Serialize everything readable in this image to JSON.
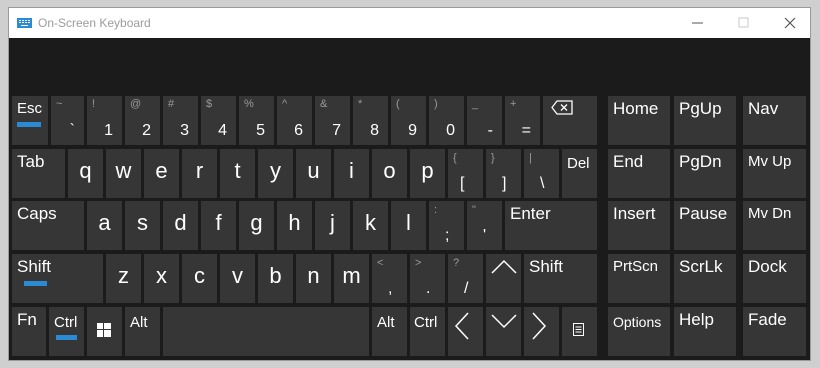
{
  "window": {
    "title": "On-Screen Keyboard",
    "accent_color": "#2a8ad3",
    "controls": [
      "minimize-icon",
      "maximize-icon",
      "close-icon"
    ]
  },
  "keys": {
    "esc": "Esc",
    "row1": [
      {
        "top": "~",
        "main": "`"
      },
      {
        "top": "!",
        "main": "1"
      },
      {
        "top": "@",
        "main": "2"
      },
      {
        "top": "#",
        "main": "3"
      },
      {
        "top": "$",
        "main": "4"
      },
      {
        "top": "%",
        "main": "5"
      },
      {
        "top": "^",
        "main": "6"
      },
      {
        "top": "&",
        "main": "7"
      },
      {
        "top": "*",
        "main": "8"
      },
      {
        "top": "(",
        "main": "9"
      },
      {
        "top": ")",
        "main": "0"
      },
      {
        "top": "_",
        "main": "-"
      },
      {
        "top": "+",
        "main": "="
      }
    ],
    "backspace_icon": "backspace-icon",
    "tab": "Tab",
    "row2": [
      "q",
      "w",
      "e",
      "r",
      "t",
      "y",
      "u",
      "i",
      "o",
      "p"
    ],
    "row2_sym": [
      {
        "top": "{",
        "main": "["
      },
      {
        "top": "}",
        "main": "]"
      },
      {
        "top": "|",
        "main": "\\"
      }
    ],
    "del": "Del",
    "caps": "Caps",
    "row3": [
      "a",
      "s",
      "d",
      "f",
      "g",
      "h",
      "j",
      "k",
      "l"
    ],
    "row3_sym": [
      {
        "top": ":",
        "main": ";"
      },
      {
        "top": "\"",
        "main": "'"
      }
    ],
    "enter": "Enter",
    "shift_left": "Shift",
    "row4": [
      "z",
      "x",
      "c",
      "v",
      "b",
      "n",
      "m"
    ],
    "row4_sym": [
      {
        "top": "<",
        "main": ","
      },
      {
        "top": ">",
        "main": "."
      },
      {
        "top": "?",
        "main": "/"
      }
    ],
    "shift_right": "Shift",
    "fn": "Fn",
    "ctrl_left": "Ctrl",
    "alt_left": "Alt",
    "alt_right": "Alt",
    "ctrl_right": "Ctrl",
    "nav": {
      "home": "Home",
      "pgup": "PgUp",
      "nav": "Nav",
      "end": "End",
      "pgdn": "PgDn",
      "mvup": "Mv Up",
      "insert": "Insert",
      "pause": "Pause",
      "mvdn": "Mv Dn",
      "prtscn": "PrtScn",
      "scrlk": "ScrLk",
      "dock": "Dock",
      "options": "Options",
      "help": "Help",
      "fade": "Fade"
    }
  }
}
